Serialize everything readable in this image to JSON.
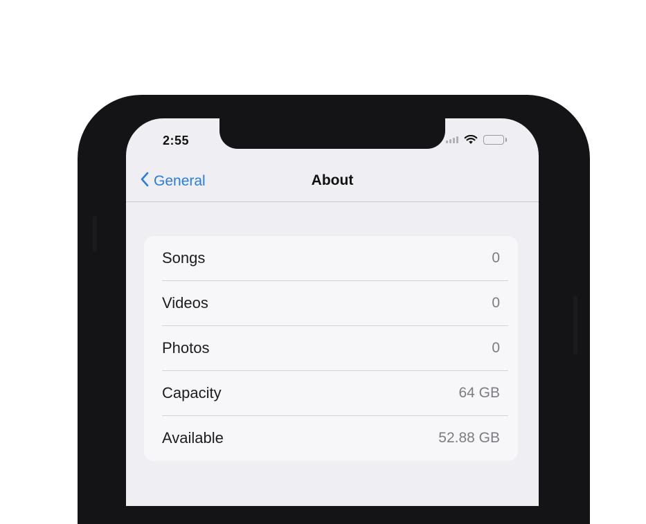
{
  "status_bar": {
    "time": "2:55",
    "icons": [
      "cellular-signal-icon",
      "wifi-icon",
      "battery-icon"
    ]
  },
  "nav": {
    "back_label": "General",
    "back_icon": "chevron-left-icon",
    "title": "About"
  },
  "rows": [
    {
      "label": "Songs",
      "value": "0"
    },
    {
      "label": "Videos",
      "value": "0"
    },
    {
      "label": "Photos",
      "value": "0"
    },
    {
      "label": "Capacity",
      "value": "64 GB"
    },
    {
      "label": "Available",
      "value": "52.88 GB"
    }
  ],
  "colors": {
    "accent": "#2a7be0",
    "screen_background": "#efeff3",
    "phone_body": "#141416"
  }
}
